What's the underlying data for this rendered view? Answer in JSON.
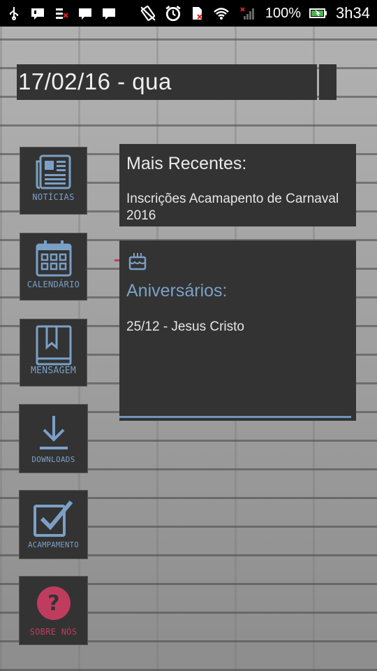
{
  "status_bar": {
    "battery": "100%",
    "time": "3h34",
    "left_icons": [
      "usb-icon",
      "message-icon",
      "signal-off-icon",
      "chat-icon",
      "chat-icon"
    ],
    "right_icons": [
      "vibrate-icon",
      "alarm-icon",
      "sim-off-icon",
      "wifi-icon",
      "cell-signal-icon",
      "battery-icon"
    ]
  },
  "date_bar": {
    "text": "17/02/16 - qua"
  },
  "menu": {
    "items": [
      {
        "label": "NOTÍCIAS",
        "icon": "newspaper-icon"
      },
      {
        "label": "CALENDÁRIO",
        "icon": "calendar-icon"
      },
      {
        "label": "MENSAGEM",
        "icon": "book-icon"
      },
      {
        "label": "DOWNLOADS",
        "icon": "download-icon"
      },
      {
        "label": "ACAMPAMENTO",
        "icon": "checkbox-icon"
      },
      {
        "label": "SOBRE NÓS",
        "icon": "help-icon"
      }
    ]
  },
  "recent": {
    "title": "Mais Recentes:",
    "item": "Inscrições Acamapento de Carnaval 2016"
  },
  "birthdays": {
    "icon": "cake-icon",
    "title": "Aniversários:",
    "item": "25/12 - Jesus Cristo"
  },
  "colors": {
    "accent": "#7ba0c6",
    "danger": "#c03c5f",
    "panel": "#333333"
  }
}
